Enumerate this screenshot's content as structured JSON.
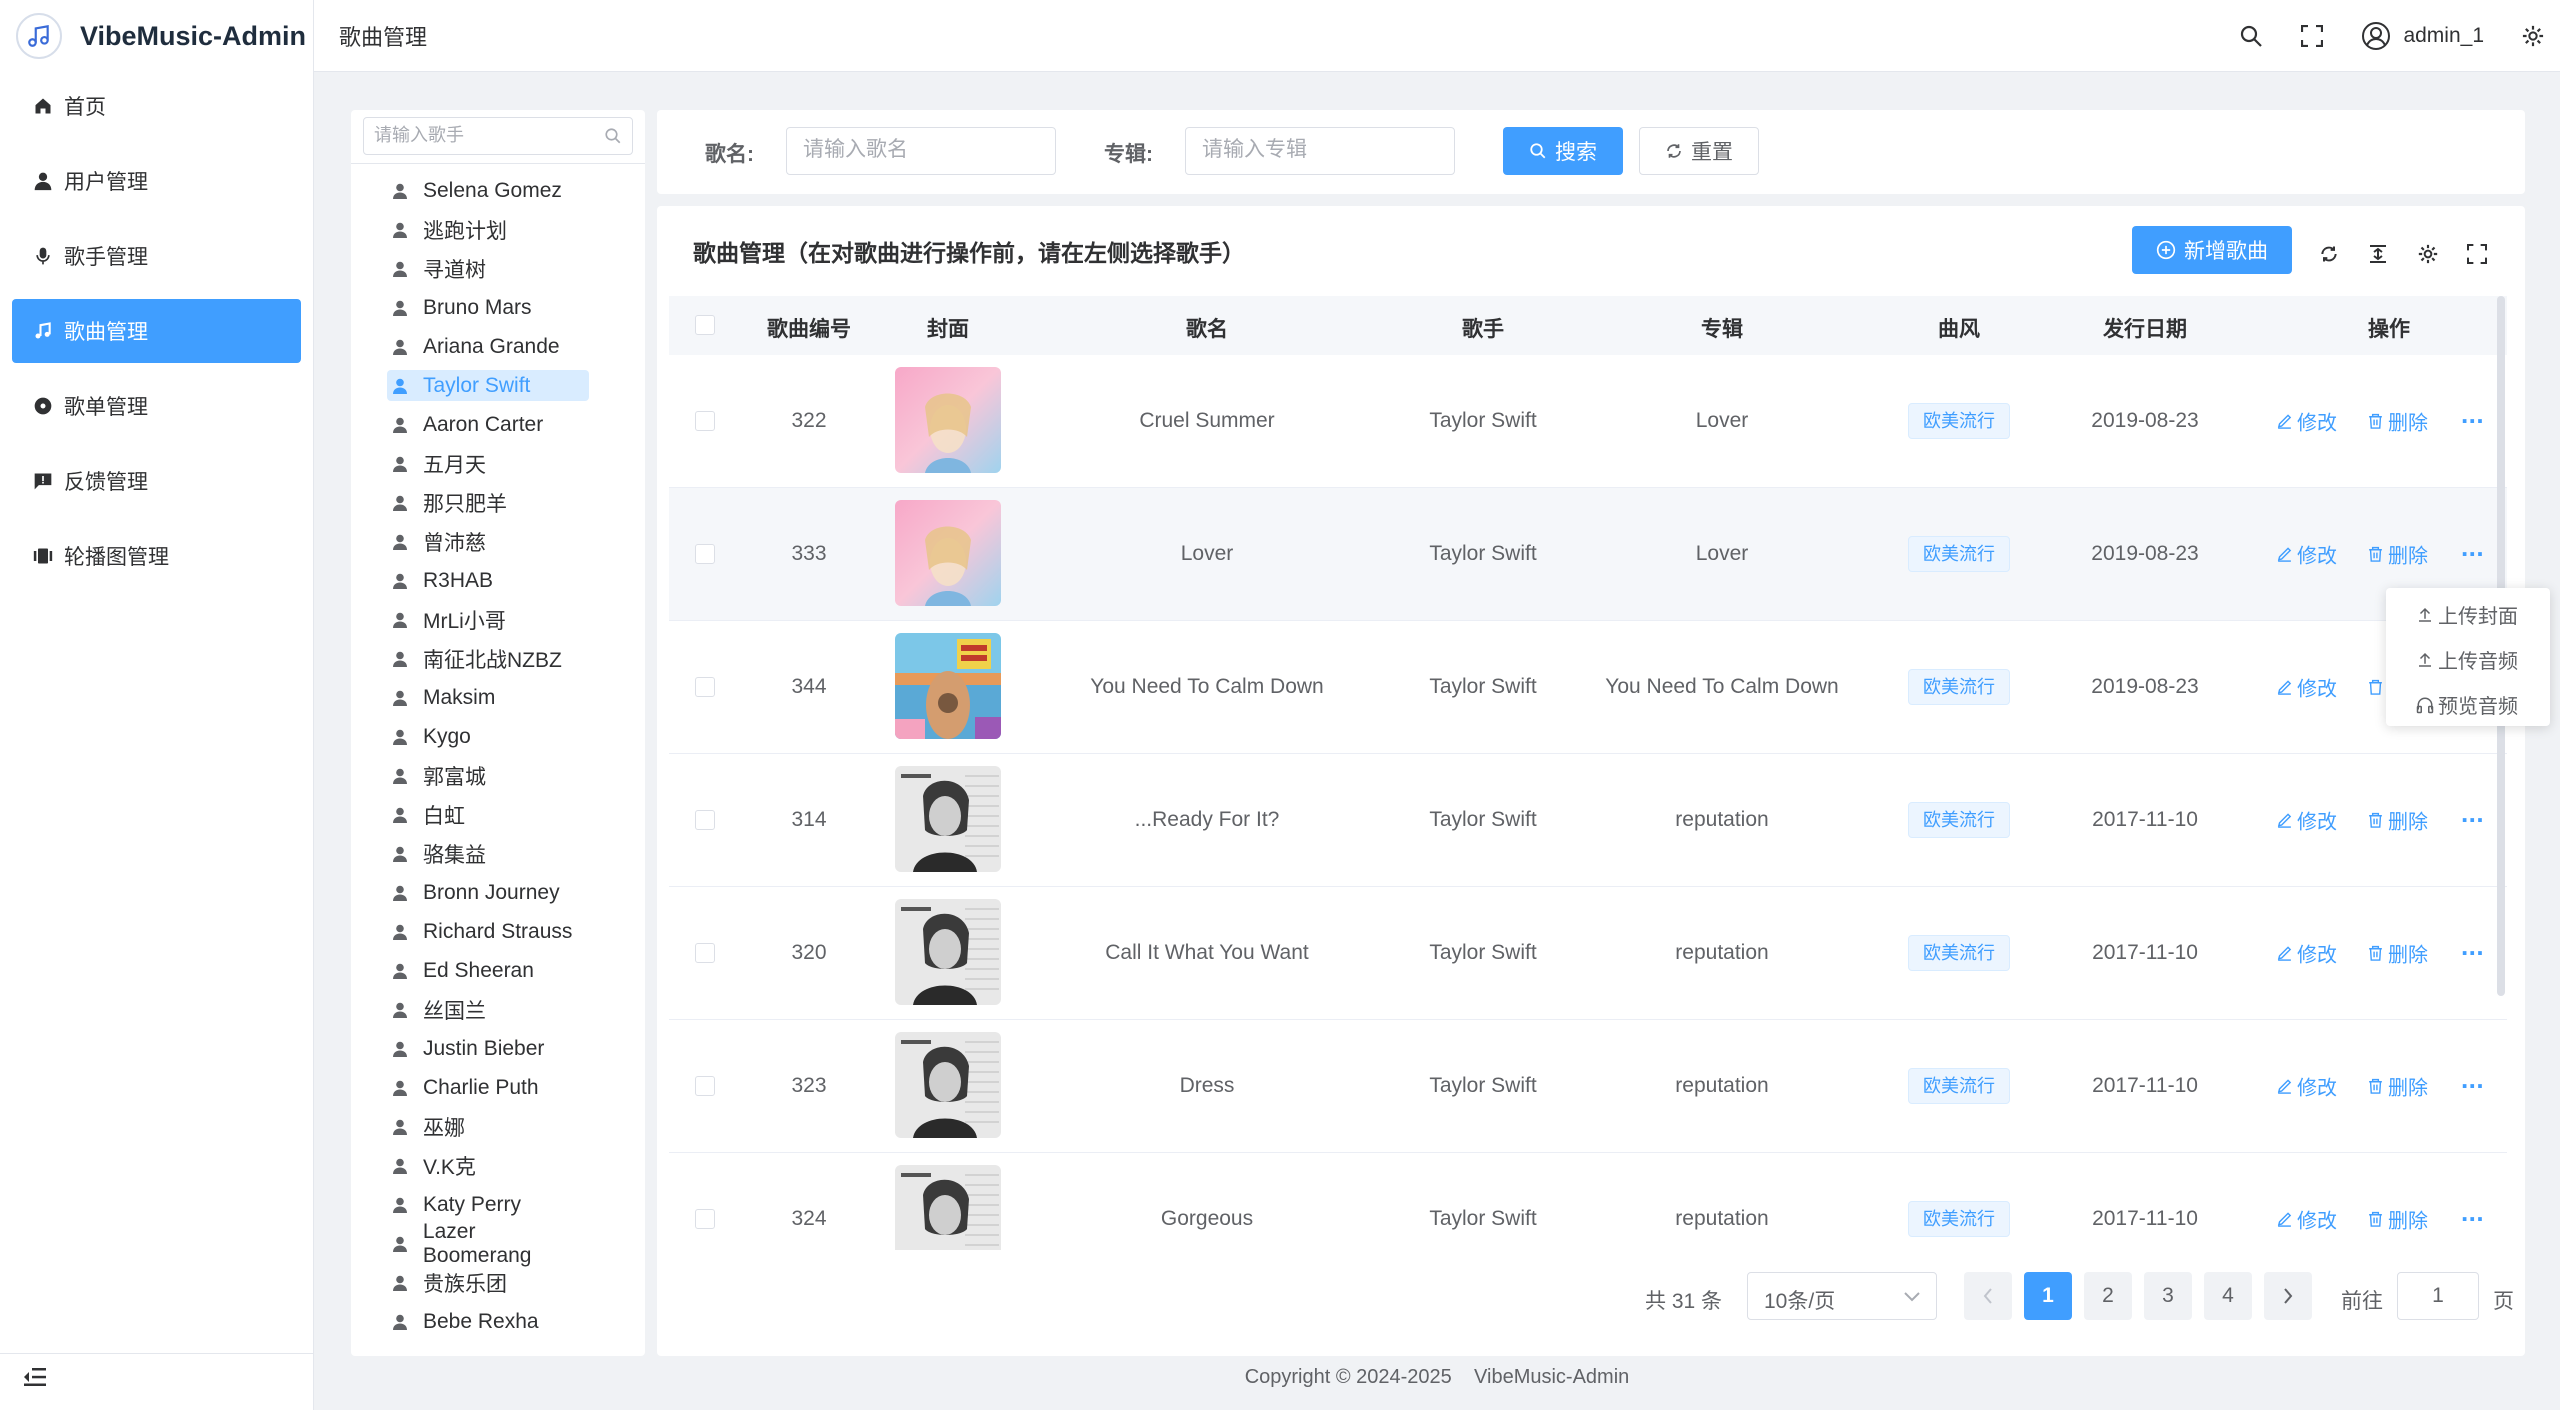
{
  "app": {
    "title": "VibeMusic-Admin"
  },
  "colors": {
    "primary": "#409eff",
    "sidebar_active": "#409eff",
    "tag_bg": "#ecf5ff"
  },
  "menu": [
    {
      "label": "首页",
      "icon": "home-icon"
    },
    {
      "label": "用户管理",
      "icon": "user-icon"
    },
    {
      "label": "歌手管理",
      "icon": "microphone-icon"
    },
    {
      "label": "歌曲管理",
      "icon": "music-note-icon",
      "active": true
    },
    {
      "label": "歌单管理",
      "icon": "record-icon"
    },
    {
      "label": "反馈管理",
      "icon": "feedback-icon"
    },
    {
      "label": "轮播图管理",
      "icon": "carousel-icon"
    }
  ],
  "header": {
    "breadcrumb": "歌曲管理",
    "username": "admin_1"
  },
  "singer_panel": {
    "search_placeholder": "请输入歌手",
    "singers": [
      "Selena Gomez",
      "逃跑计划",
      "寻道树",
      "Bruno Mars",
      "Ariana Grande",
      "Taylor Swift",
      "Aaron Carter",
      "五月天",
      "那只肥羊",
      "曾沛慈",
      "R3HAB",
      "MrLi小哥",
      "南征北战NZBZ",
      "Maksim",
      "Kygo",
      "郭富城",
      "白虹",
      "骆集益",
      "Bronn Journey",
      "Richard Strauss",
      "Ed Sheeran",
      "丝国兰",
      "Justin Bieber",
      "Charlie Puth",
      "巫娜",
      "V.K克",
      "Katy Perry",
      "Lazer Boomerang",
      "贵族乐团",
      "Bebe Rexha"
    ],
    "active": "Taylor Swift"
  },
  "filters": {
    "song_label": "歌名:",
    "song_placeholder": "请输入歌名",
    "album_label": "专辑:",
    "album_placeholder": "请输入专辑",
    "search_button": "搜索",
    "reset_button": "重置"
  },
  "table": {
    "title": "歌曲管理（在对歌曲进行操作前，请在左侧选择歌手）",
    "add_button": "新增歌曲",
    "columns": [
      "歌曲编号",
      "封面",
      "歌名",
      "歌手",
      "专辑",
      "曲风",
      "发行日期",
      "操作"
    ],
    "edit_label": "修改",
    "delete_label": "删除",
    "rows": [
      {
        "id": "322",
        "cover": "lover",
        "name": "Cruel Summer",
        "singer": "Taylor Swift",
        "album": "Lover",
        "style": "欧美流行",
        "date": "2019-08-23"
      },
      {
        "id": "333",
        "cover": "lover",
        "name": "Lover",
        "singer": "Taylor Swift",
        "album": "Lover",
        "style": "欧美流行",
        "date": "2019-08-23"
      },
      {
        "id": "344",
        "cover": "calm",
        "name": "You Need To Calm Down",
        "singer": "Taylor Swift",
        "album": "You Need To Calm Down",
        "style": "欧美流行",
        "date": "2019-08-23"
      },
      {
        "id": "314",
        "cover": "reputation",
        "name": "...Ready For It?",
        "singer": "Taylor Swift",
        "album": "reputation",
        "style": "欧美流行",
        "date": "2017-11-10"
      },
      {
        "id": "320",
        "cover": "reputation",
        "name": "Call It What You Want",
        "singer": "Taylor Swift",
        "album": "reputation",
        "style": "欧美流行",
        "date": "2017-11-10"
      },
      {
        "id": "323",
        "cover": "reputation",
        "name": "Dress",
        "singer": "Taylor Swift",
        "album": "reputation",
        "style": "欧美流行",
        "date": "2017-11-10"
      },
      {
        "id": "324",
        "cover": "reputation",
        "name": "Gorgeous",
        "singer": "Taylor Swift",
        "album": "reputation",
        "style": "欧美流行",
        "date": "2017-11-10"
      }
    ]
  },
  "more_menu": [
    "上传封面",
    "上传音频",
    "预览音频"
  ],
  "pagination": {
    "total": "共 31 条",
    "page_size": "10条/页",
    "pages": [
      "1",
      "2",
      "3",
      "4"
    ],
    "current": "1",
    "goto_label": "前往",
    "goto_value": "1",
    "goto_unit": "页"
  },
  "footer": {
    "copyright": "Copyright © 2024-2025",
    "app_name": "VibeMusic-Admin"
  }
}
